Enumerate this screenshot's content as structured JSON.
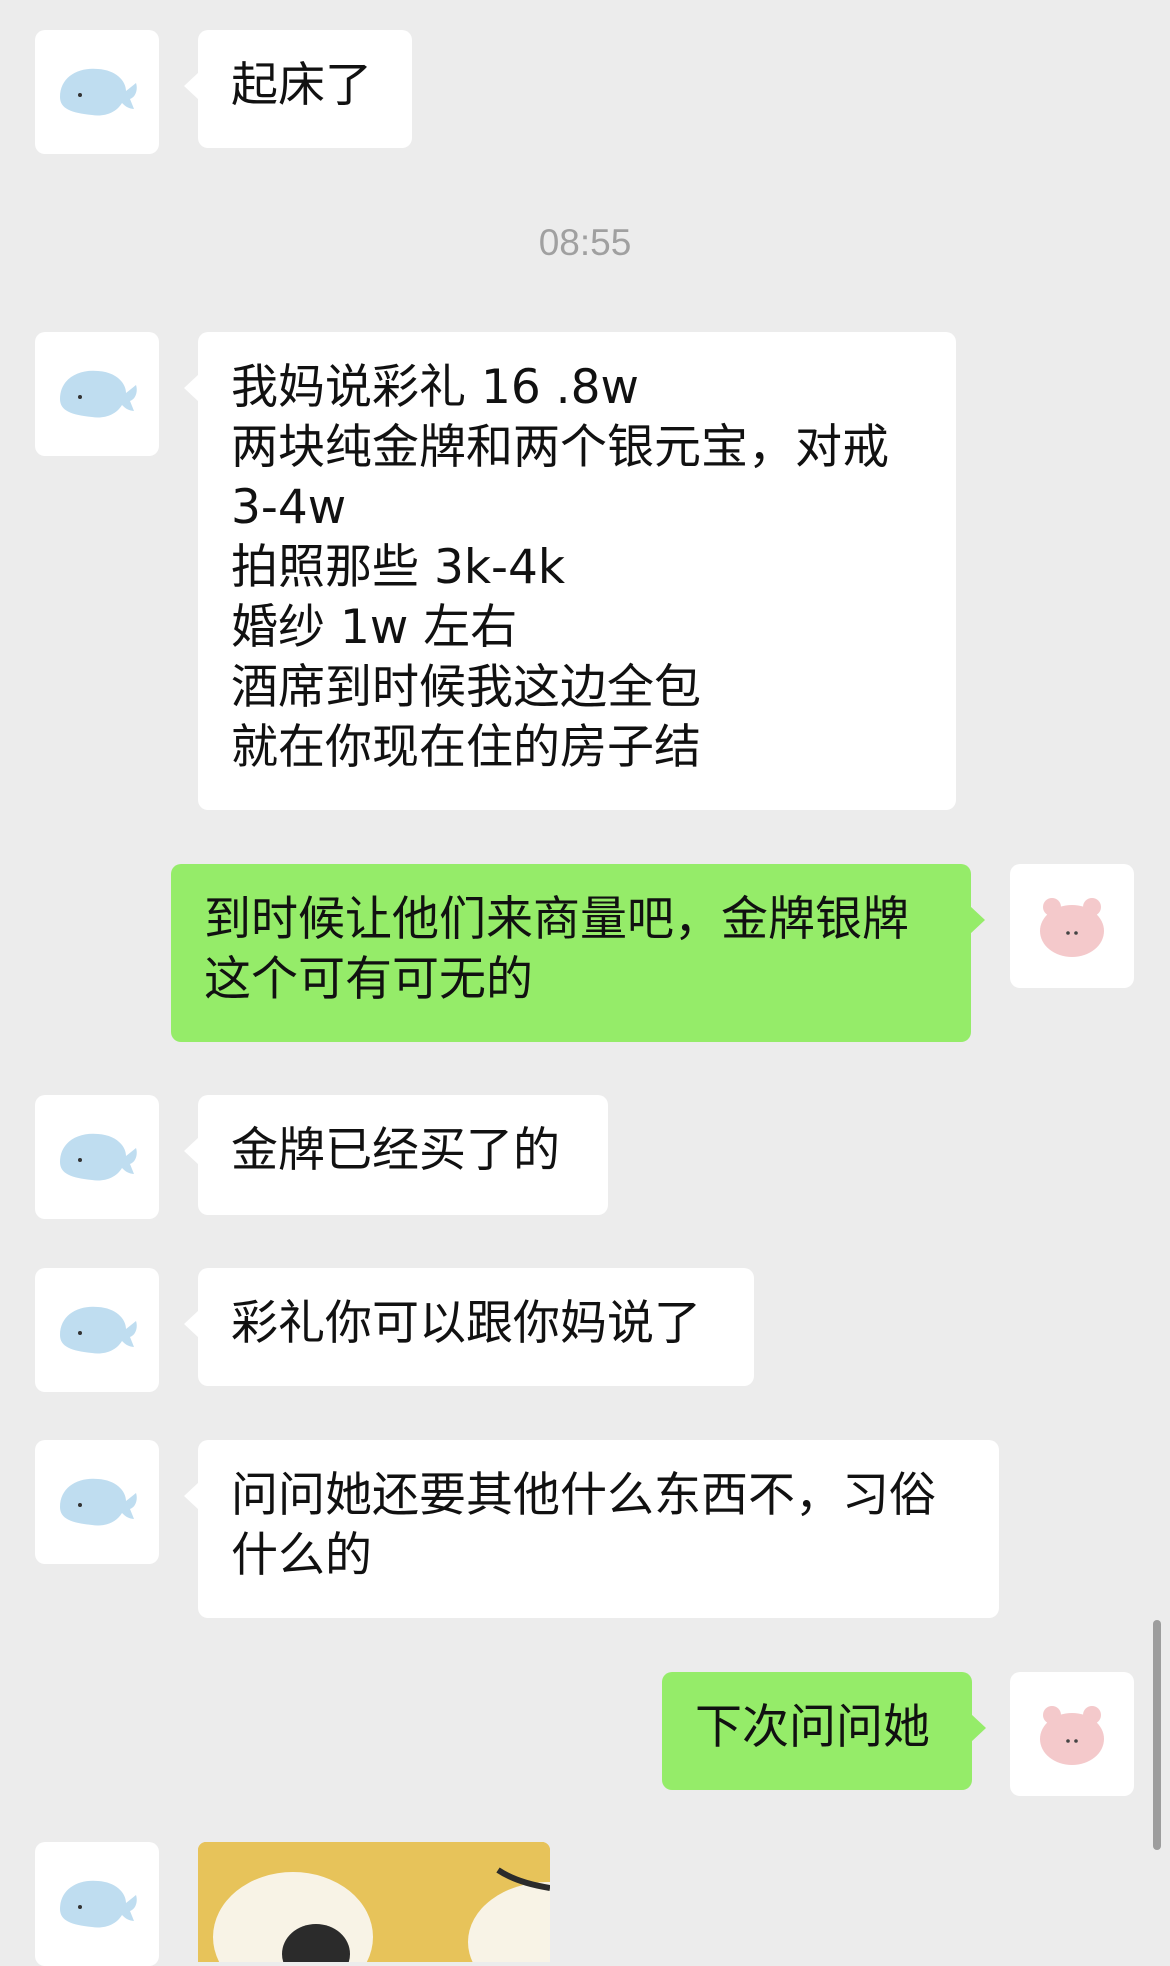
{
  "colors": {
    "background": "#ECECEC",
    "incoming_bubble": "#FFFFFF",
    "outgoing_bubble": "#95EC69",
    "timestamp_text": "#A0A0A0"
  },
  "icons": {
    "contact_avatar": "whale-avatar-icon",
    "self_avatar": "pink-bear-avatar-icon",
    "image_message": "sticker-image-icon"
  },
  "messages": {
    "m1": "起床了",
    "time1": "08:55",
    "m2": "我妈说彩礼 16 .8w\n两块纯金牌和两个银元宝，对戒\n3-4w\n拍照那些 3k-4k\n婚纱 1w 左右\n酒席到时候我这边全包\n就在你现在住的房子结",
    "m3": "到时候让他们来商量吧，金牌银牌\n这个可有可无的",
    "m4": "金牌已经买了的",
    "m5": "彩礼你可以跟你妈说了",
    "m6": "问问她还要其他什么东西不，习俗\n什么的",
    "m7": "下次问问她"
  }
}
